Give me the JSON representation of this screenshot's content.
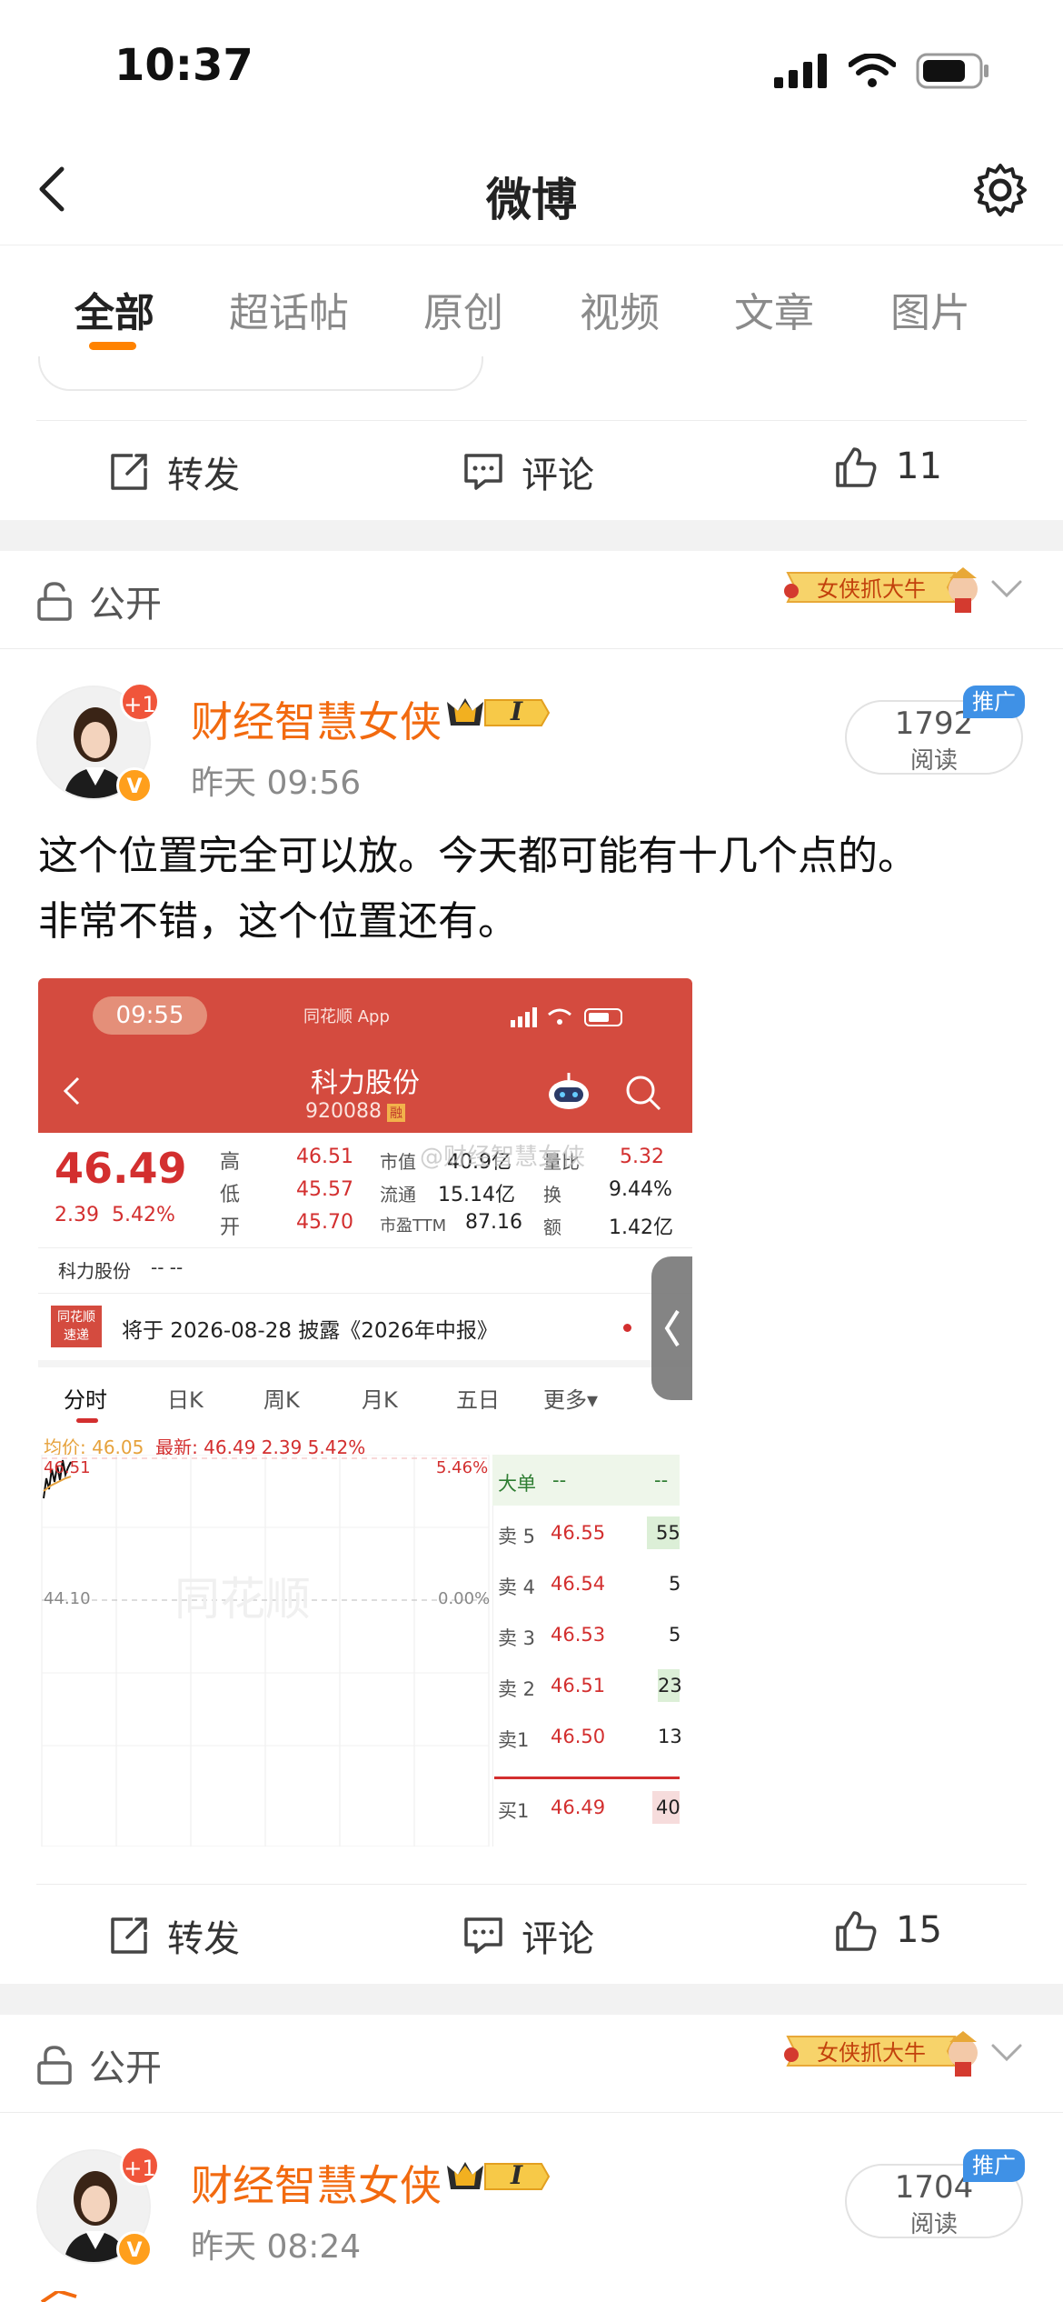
{
  "status_bar": {
    "time": "10:37"
  },
  "nav": {
    "title": "微博"
  },
  "tabs": [
    {
      "label": "全部",
      "active": true
    },
    {
      "label": "超话帖",
      "active": false
    },
    {
      "label": "原创",
      "active": false
    },
    {
      "label": "视频",
      "active": false
    },
    {
      "label": "文章",
      "active": false
    },
    {
      "label": "图片",
      "active": false
    }
  ],
  "actions": {
    "repost": "转发",
    "comment": "评论"
  },
  "prev_post": {
    "likes": "11"
  },
  "posts": [
    {
      "visibility": "公开",
      "badge_text": "女侠抓大牛",
      "author": "财经智慧女侠",
      "vip_level": "I",
      "avatar_plus": "+1",
      "avatar_v": "V",
      "time": "昨天 09:56",
      "reads": "1792",
      "reads_label": "阅读",
      "promo": "推广",
      "text_line1": "这个位置完全可以放。今天都可能有十几个点的。",
      "text_line2": "非常不错，这个位置还有。",
      "likes": "15"
    },
    {
      "visibility": "公开",
      "badge_text": "女侠抓大牛",
      "author": "财经智慧女侠",
      "vip_level": "I",
      "avatar_plus": "+1",
      "avatar_v": "V",
      "time": "昨天 08:24",
      "reads": "1704",
      "reads_label": "阅读",
      "promo": "推广"
    }
  ],
  "screenshot": {
    "time": "09:55",
    "app": "同花顺 App",
    "stock_name": "科力股份",
    "stock_code": "920088",
    "rong": "融",
    "price": "46.49",
    "change": "2.39",
    "change_pct": "5.42%",
    "quotes": [
      {
        "l1": "高",
        "v1": "46.51",
        "l2": "市值",
        "v2": "40.9亿",
        "l3": "量比",
        "v3": "5.32"
      },
      {
        "l1": "低",
        "v1": "45.57",
        "l2": "流通",
        "v2": "15.14亿",
        "l3": "换",
        "v3": "9.44%"
      },
      {
        "l1": "开",
        "v1": "45.70",
        "l2": "市盈TTM",
        "v2": "87.16",
        "l3": "额",
        "v3": "1.42亿"
      }
    ],
    "watermark": "@财经智慧女侠",
    "row_name": "科力股份",
    "row_dash": "--    --",
    "news_logo": "同花顺 速递",
    "news_text": "将于 2026-08-28 披露《2026年中报》",
    "chart_tabs": [
      "分时",
      "日K",
      "周K",
      "月K",
      "五日",
      "更多▾"
    ],
    "avg_label": "均价: 46.05",
    "latest_label": "最新: 46.49  2.39  5.42%",
    "chart_top": "46.51",
    "chart_top_pct": "5.46%",
    "chart_mid": "44.10",
    "chart_mid_pct": "0.00%",
    "big_order": "大单",
    "big_order_vals": "--",
    "big_order_vals2": "--",
    "order_book": [
      {
        "side": "卖 5",
        "price": "46.55",
        "vol": "55"
      },
      {
        "side": "卖 4",
        "price": "46.54",
        "vol": "5"
      },
      {
        "side": "卖 3",
        "price": "46.53",
        "vol": "5"
      },
      {
        "side": "卖 2",
        "price": "46.51",
        "vol": "23"
      },
      {
        "side": "卖1",
        "price": "46.50",
        "vol": "13"
      },
      {
        "side": "买1",
        "price": "46.49",
        "vol": "40"
      }
    ]
  },
  "colors": {
    "accent": "#ff8200",
    "author": "#f26a0f",
    "stock_red": "#d44b3f"
  }
}
